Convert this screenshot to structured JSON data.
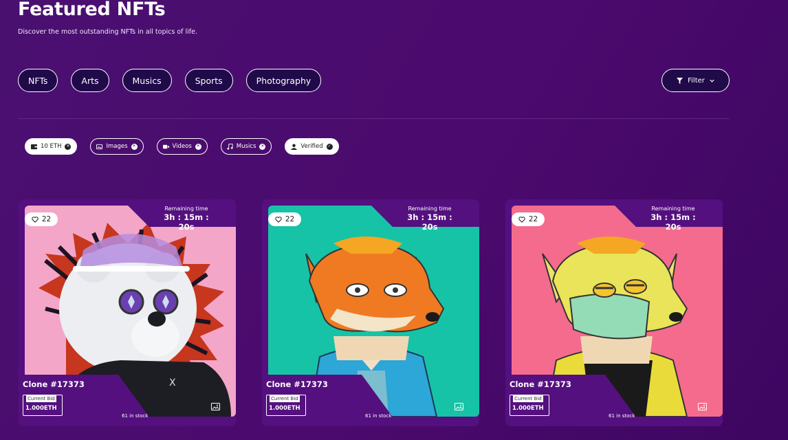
{
  "header": {
    "title": "Featured NFTs",
    "subtitle": "Discover the most outstanding NFTs in all topics of life."
  },
  "categories": [
    "NFTs",
    "Arts",
    "Musics",
    "Sports",
    "Photography"
  ],
  "filter": {
    "label": "Filter",
    "icon": "funnel-icon"
  },
  "tags": [
    {
      "label": "10 ETH",
      "icon": "wallet-icon",
      "style": "light",
      "action": "remove"
    },
    {
      "label": "Images",
      "icon": "images-icon",
      "style": "dark",
      "action": "remove"
    },
    {
      "label": "Videos",
      "icon": "video-icon",
      "style": "dark",
      "action": "remove"
    },
    {
      "label": "Musics",
      "icon": "music-icon",
      "style": "dark",
      "action": "remove"
    },
    {
      "label": "Verified",
      "icon": "user-icon",
      "style": "light",
      "action": "verified"
    }
  ],
  "cards": [
    {
      "likes": "22",
      "remaining_label": "Remaining time",
      "remaining_time": "3h : 15m : 20s",
      "name": "Clone #17373",
      "bid_label": "Current Bid",
      "bid_value": "1.000ETH",
      "stock": "61 in stock",
      "art_bg": "#f4a6c9",
      "art": "bear"
    },
    {
      "likes": "22",
      "remaining_label": "Remaining time",
      "remaining_time": "3h : 15m : 20s",
      "name": "Clone #17373",
      "bid_label": "Current Bid",
      "bid_value": "1.000ETH",
      "stock": "61 in stock",
      "art_bg": "#17c3a6",
      "art": "fox"
    },
    {
      "likes": "22",
      "remaining_label": "Remaining time",
      "remaining_time": "3h : 15m : 20s",
      "name": "Clone #17373",
      "bid_label": "Current Bid",
      "bid_value": "1.000ETH",
      "stock": "61 in stock",
      "art_bg": "#f56b8d",
      "art": "masked-fox"
    }
  ],
  "colors": {
    "background": "#4b0a6e",
    "card": "#54107f",
    "pill_bg": "#200a4a"
  }
}
